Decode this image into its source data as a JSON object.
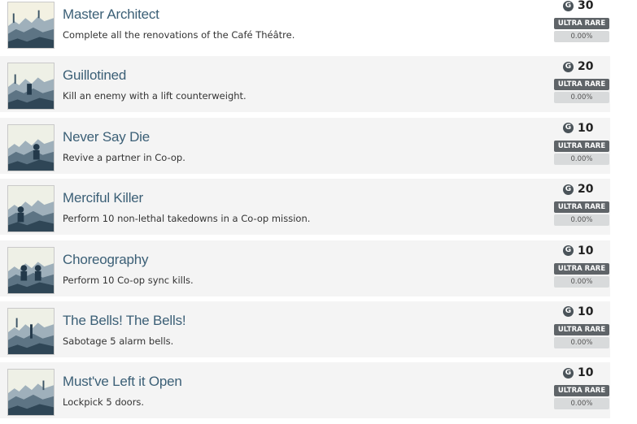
{
  "achievements": [
    {
      "title": "Master Architect",
      "description": "Complete all the renovations of the Café Théâtre.",
      "points": "30",
      "rarity": "ULTRA RARE",
      "percent": "0.00%"
    },
    {
      "title": "Guillotined",
      "description": "Kill an enemy with a lift counterweight.",
      "points": "20",
      "rarity": "ULTRA RARE",
      "percent": "0.00%"
    },
    {
      "title": "Never Say Die",
      "description": "Revive a partner in Co-op.",
      "points": "10",
      "rarity": "ULTRA RARE",
      "percent": "0.00%"
    },
    {
      "title": "Merciful Killer",
      "description": "Perform 10 non-lethal takedowns in a Co-op mission.",
      "points": "20",
      "rarity": "ULTRA RARE",
      "percent": "0.00%"
    },
    {
      "title": "Choreography",
      "description": "Perform 10 Co-op sync kills.",
      "points": "10",
      "rarity": "ULTRA RARE",
      "percent": "0.00%"
    },
    {
      "title": "The Bells! The Bells!",
      "description": "Sabotage 5 alarm bells.",
      "points": "10",
      "rarity": "ULTRA RARE",
      "percent": "0.00%"
    },
    {
      "title": "Must've Left it Open",
      "description": "Lockpick 5 doors.",
      "points": "10",
      "rarity": "ULTRA RARE",
      "percent": "0.00%"
    }
  ],
  "gamerscore_icon": {
    "glyph": "G",
    "name": "gamerscore-icon",
    "color": "#4a5359"
  },
  "colors": {
    "title": "#3b5f76",
    "row_bg": "#f4f4f4",
    "rarity_bg": "#5f6468",
    "percent_bg": "#d8dadb"
  }
}
